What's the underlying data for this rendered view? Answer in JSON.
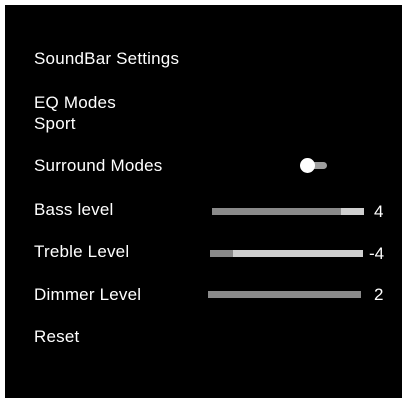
{
  "menu": {
    "title": "SoundBar Settings",
    "eq": {
      "label": "EQ Modes",
      "value": "Sport"
    },
    "surround": {
      "label": "Surround Modes",
      "state": "off"
    },
    "bass": {
      "label": "Bass level",
      "value": "4",
      "level": 0.85
    },
    "treble": {
      "label": "Treble Level",
      "value": "-4",
      "level": 0.15
    },
    "dimmer": {
      "label": "Dimmer Level",
      "value": "2",
      "level": 1.0
    },
    "reset": {
      "label": "Reset"
    }
  },
  "colors": {
    "background": "#000000",
    "text": "#ffffff",
    "slider_track": "#cfcfcf",
    "slider_fill": "#8a8a8a",
    "toggle_track": "#9e9e9e"
  }
}
